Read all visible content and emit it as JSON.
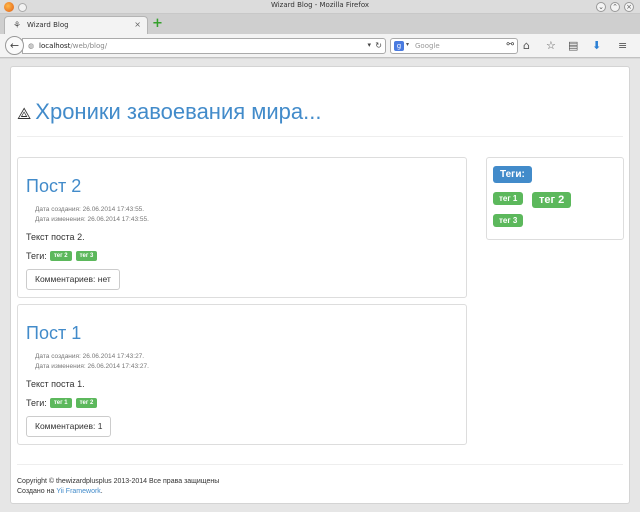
{
  "window": {
    "title": "Wizard Blog - Mozilla Firefox",
    "controls": [
      "⌄",
      "⌃",
      "×"
    ]
  },
  "tab": {
    "label": "Wizard Blog",
    "close": "×"
  },
  "newtab": {
    "label": "+"
  },
  "nav": {
    "url_host": "localhost",
    "url_path": "/web/blog/",
    "search_placeholder": "Google"
  },
  "colors": {
    "link": "#428bca",
    "tag": "#5cb85c",
    "tags_header": "#428bca"
  },
  "site": {
    "title": "Хроники завоевания мира..."
  },
  "posts": [
    {
      "title": "Пост 2",
      "created": "Дата создания: 26.06.2014 17:43:55.",
      "modified": "Дата изменения: 26.06.2014 17:43:55.",
      "text": "Текст поста 2.",
      "tags_label": "Теги:",
      "tags": [
        "тег 2",
        "тег 3"
      ],
      "comments": "Комментариев: нет"
    },
    {
      "title": "Пост 1",
      "created": "Дата создания: 26.06.2014 17:43:27.",
      "modified": "Дата изменения: 26.06.2014 17:43:27.",
      "text": "Текст поста 1.",
      "tags_label": "Теги:",
      "tags": [
        "тег 1",
        "тег 2"
      ],
      "comments": "Комментариев: 1"
    }
  ],
  "sidebar": {
    "header": "Теги:",
    "tags": [
      "тег 1",
      "тег 2",
      "тег 3"
    ]
  },
  "footer": {
    "copyright": "Copyright © thewizardplusplus 2013-2014 Все права защищены",
    "made_with": "Создано на",
    "framework": "Yii Framework",
    "period": "."
  }
}
